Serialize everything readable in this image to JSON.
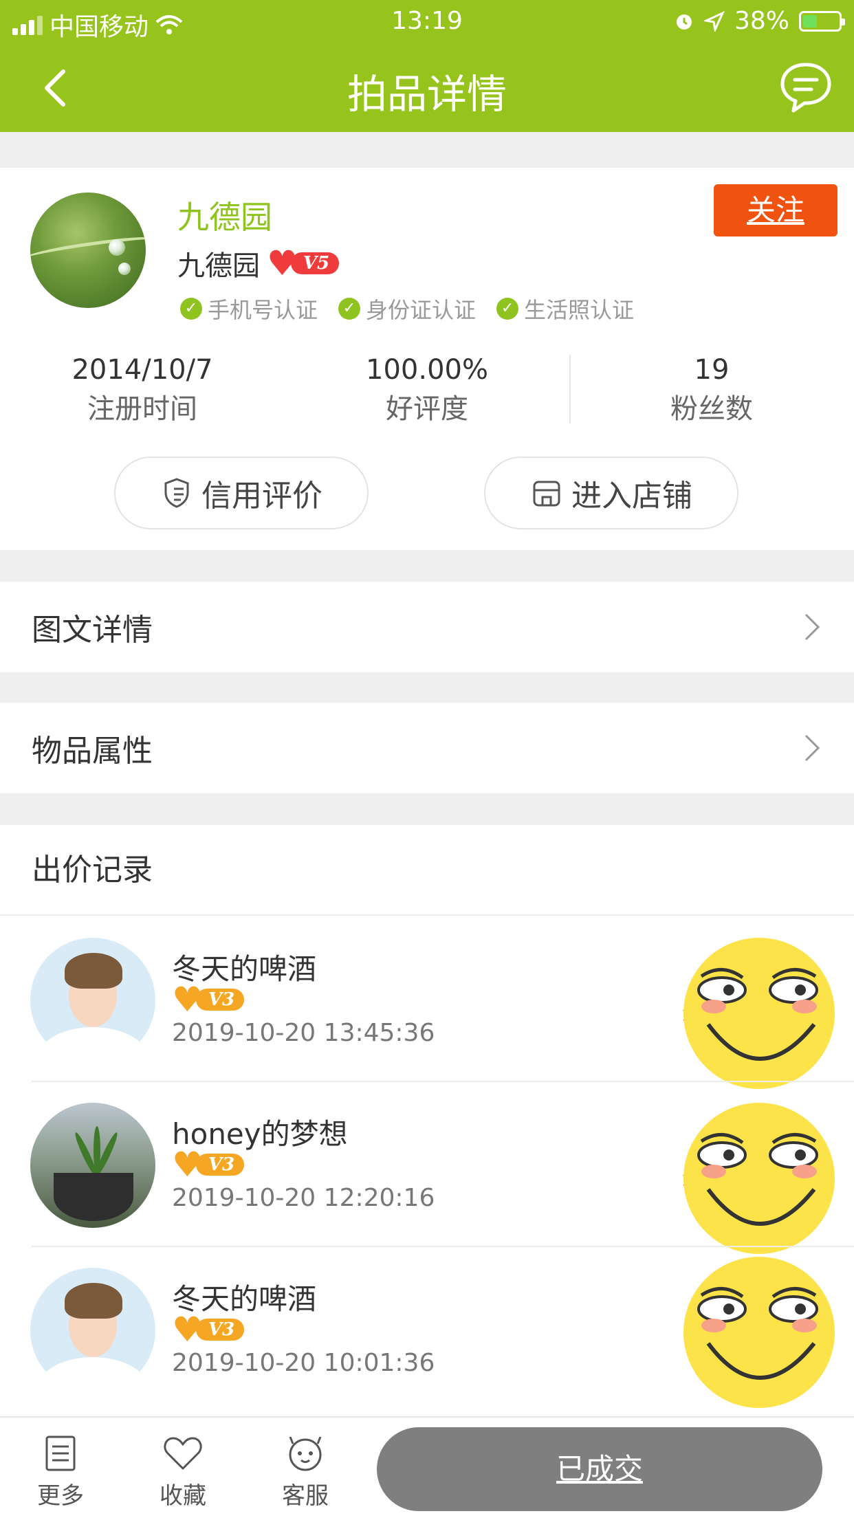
{
  "status_bar": {
    "carrier": "中国移动",
    "time": "13:19",
    "battery": "38%"
  },
  "nav": {
    "title": "拍品详情",
    "back_icon": "chevron-left-icon",
    "message_icon": "chat-bubble-icon"
  },
  "seller": {
    "shop_name": "九德园",
    "nickname": "九德园",
    "level": "V5",
    "follow_label": "关注",
    "certifications": [
      "手机号认证",
      "身份证认证",
      "生活照认证"
    ],
    "stats": [
      {
        "value": "2014/10/7",
        "label": "注册时间"
      },
      {
        "value": "100.00%",
        "label": "好评度"
      },
      {
        "value": "19",
        "label": "粉丝数"
      }
    ],
    "credit_label": "信用评价",
    "store_label": "进入店铺"
  },
  "sections": {
    "image_detail": "图文详情",
    "attributes": "物品属性"
  },
  "bids": {
    "title": "出价记录",
    "items": [
      {
        "name": "冬天的啤酒",
        "level": "V3",
        "time": "2019-10-20 13:45:36",
        "price_prefix": "¥"
      },
      {
        "name": "honey的梦想",
        "level": "V3",
        "time": "2019-10-20 12:20:16",
        "price_prefix": "¥"
      },
      {
        "name": "冬天的啤酒",
        "level": "V3",
        "time": "2019-10-20 10:01:36",
        "price_prefix": ""
      }
    ]
  },
  "bottom_bar": {
    "more": "更多",
    "favorite": "收藏",
    "service": "客服",
    "status_button": "已成交"
  },
  "colors": {
    "brand_green": "#97c31d",
    "follow_orange": "#f0520f",
    "done_gray": "#7f7f7f"
  }
}
